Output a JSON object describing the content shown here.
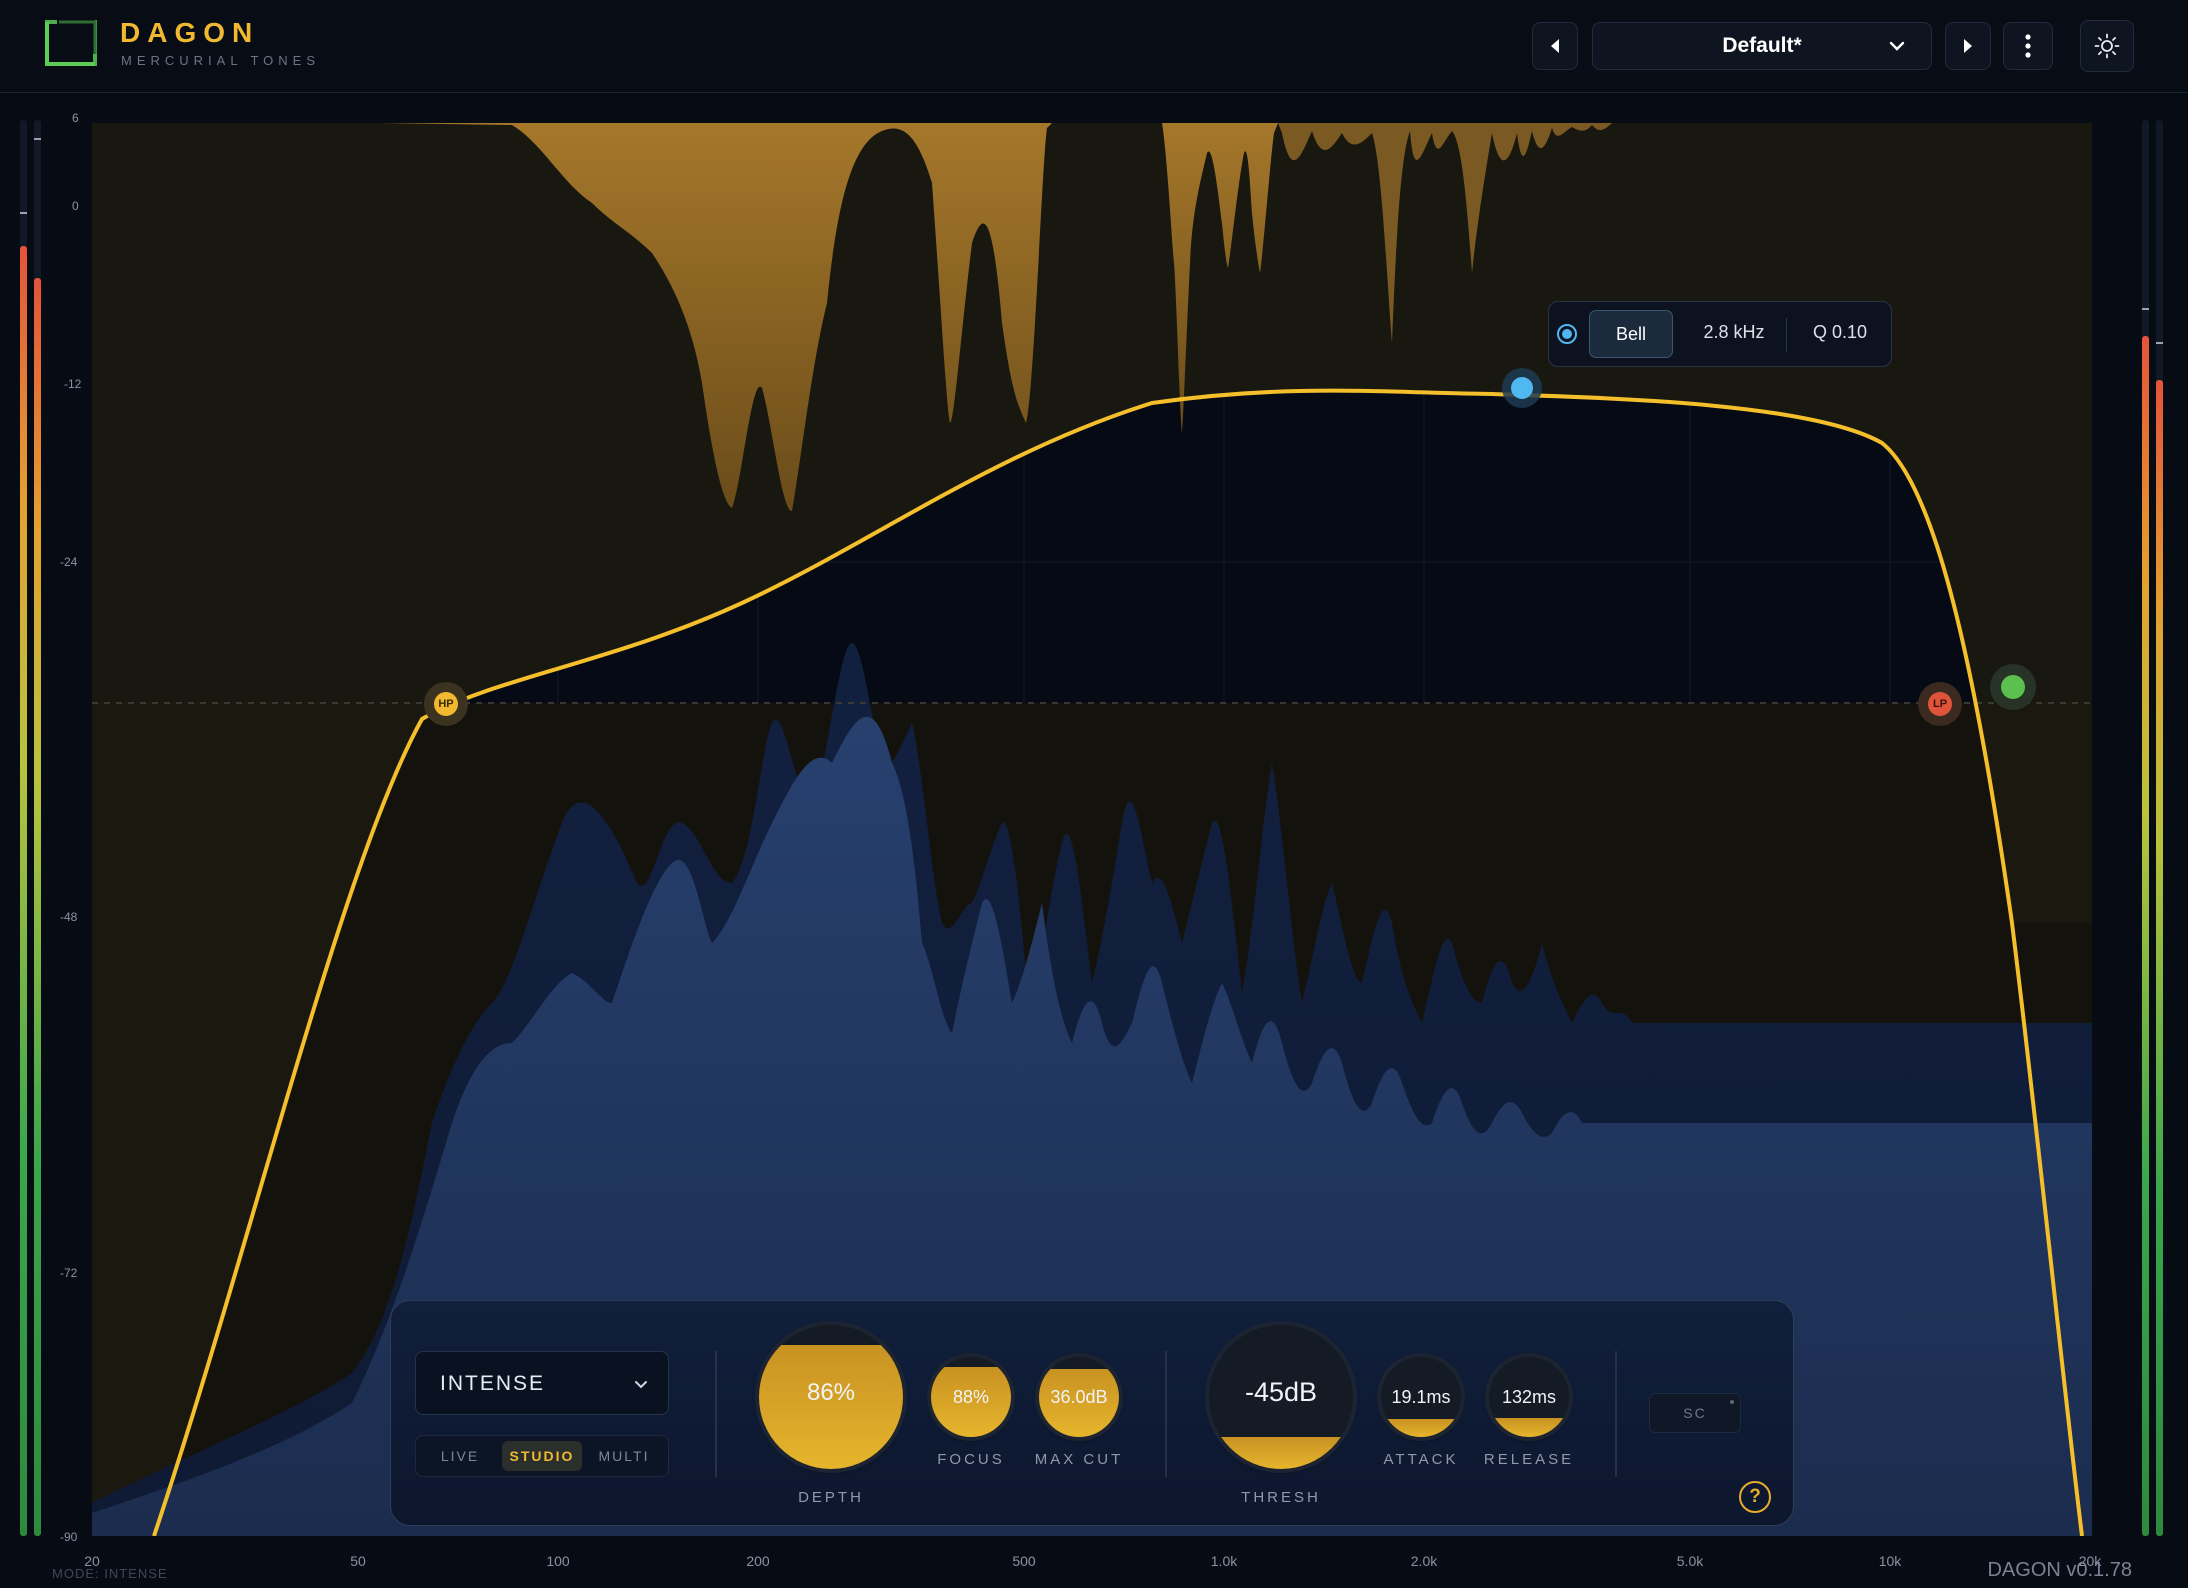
{
  "header": {
    "brand_name": "DAGON",
    "brand_sub": "MERCURIAL TONES",
    "preset_name": "Default*",
    "prev_icon": "triangle-left-icon",
    "next_icon": "triangle-right-icon",
    "menu_icon": "vertical-dots-icon",
    "settings_icon": "sun-icon",
    "brand_color": "#f0b930",
    "logo_color": "#4caf50"
  },
  "plot": {
    "y_ticks": [
      "6",
      "0",
      "-12",
      "-24",
      "-48",
      "-72",
      "-90"
    ],
    "x_ticks": [
      "20",
      "50",
      "100",
      "200",
      "500",
      "1.0k",
      "2.0k",
      "5.0k",
      "10k",
      "20k"
    ],
    "curve_color": "#f5bf2b",
    "node_colors": {
      "bell": "#4fb8f0",
      "hp": "#f0b930",
      "lp": "#e0553a",
      "extra": "#5cc04e"
    }
  },
  "nodes": {
    "hp_label": "HP",
    "lp_label": "LP"
  },
  "band_popup": {
    "type": "Bell",
    "freq": "2.8 kHz",
    "q": "Q 0.10"
  },
  "controls": {
    "mode_select": "INTENSE",
    "modes": [
      "LIVE",
      "STUDIO",
      "MULTI"
    ],
    "selected_mode": "STUDIO",
    "knobs": {
      "depth": {
        "value": "86%",
        "label": "DEPTH",
        "level": 0.86
      },
      "focus": {
        "value": "88%",
        "label": "FOCUS",
        "level": 0.88
      },
      "max_cut": {
        "value": "36.0dB",
        "label": "MAX CUT",
        "level": 0.85
      },
      "thresh": {
        "value": "-45dB",
        "label": "THRESH",
        "level": 0.22
      },
      "attack": {
        "value": "19.1ms",
        "label": "ATTACK",
        "level": 0.22
      },
      "release": {
        "value": "132ms",
        "label": "RELEASE",
        "level": 0.24
      }
    },
    "sc_label": "SC",
    "help_label": "?"
  },
  "footer": {
    "mode_text": "MODE: INTENSE",
    "version": "DAGON v0.1.78"
  }
}
